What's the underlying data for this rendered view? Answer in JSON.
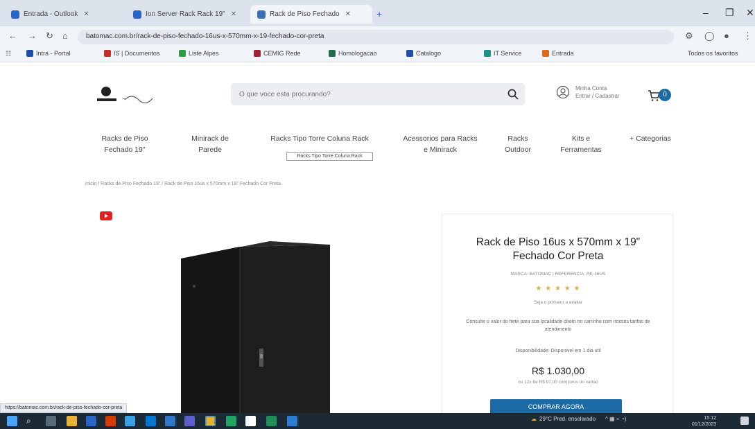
{
  "browser": {
    "tabs": [
      {
        "title": "Entrada - Outlook",
        "color": "#2a64c5",
        "active": false
      },
      {
        "title": "Ion Server Rack Rack 19\"",
        "color": "#2a64c5",
        "active": false
      },
      {
        "title": "Rack de Piso Fechado",
        "color": "#3b6fb8",
        "active": true
      }
    ],
    "new_tab": "+",
    "url": "batomac.com.br/rack-de-piso-fechado-16us-x-570mm-x-19-fechado-cor-preta",
    "bookmarks": [
      {
        "label": "Intra - Portal",
        "color": "#1f4fa3"
      },
      {
        "label": "IS | Documentos",
        "color": "#c4302b"
      },
      {
        "label": "Liste Alpes",
        "color": "#2e9c44"
      },
      {
        "label": "CEMIG Rede",
        "color": "#a31f34"
      },
      {
        "label": "Homologacao",
        "color": "#1f6f4a"
      },
      {
        "label": "Catalogo",
        "color": "#1f4fa3"
      },
      {
        "label": "IT Service",
        "color": "#1f8f8a"
      },
      {
        "label": "Entrada",
        "color": "#e06a1b"
      }
    ],
    "bookmarks_other": "Todos os favoritos"
  },
  "header": {
    "search_placeholder": "O que voce esta procurando?",
    "account_line1": "Minha Conta",
    "account_line2": "Entrar / Cadastrar",
    "cart_count": "0"
  },
  "nav": {
    "items": [
      "Racks de Piso Fechado 19\"",
      "Minirack de Parede",
      "Racks Tipo Torre Coluna Rack",
      "Acessorios para Racks e Minirack",
      "Racks Outdoor",
      "Kits e Ferramentas",
      "+ Categorias"
    ],
    "tooltip": "Racks Tipo Torre Coluna Rack"
  },
  "breadcrumb": "Inicio / Racks de Piso Fechado 19\" / Rack de Piso 16us x 570mm x 19\" Fechado Cor Preta",
  "product": {
    "title": "Rack de Piso 16us x 570mm x 19\" Fechado Cor Preta",
    "sku": "MARCA: BATOMAC  |  REFERENCIA: RK-16US",
    "stars": "★ ★ ★ ★ ★",
    "reviews": "Seja o primeiro a avaliar",
    "description": "Consulte o valor do frete para sua localidade direto no carrinho com nossos tarifas de atendimento",
    "stock": "Disponibilidade: Disponivel em 1 dia util",
    "price": "R$ 1.030,00",
    "installments": "ou 12x de R$ 97,00 com juros no cartao",
    "buy_label": "COMPRAR AGORA"
  },
  "status_url": "https://batomac.com.br/rack-de-piso-fechado-cor-preta",
  "taskbar": {
    "weather": "29°C  Pred. ensolarado",
    "time": "15:12",
    "date": "01/12/2023"
  },
  "colors": {
    "brand": "#1b6aa5",
    "youtube": "#e52222"
  }
}
